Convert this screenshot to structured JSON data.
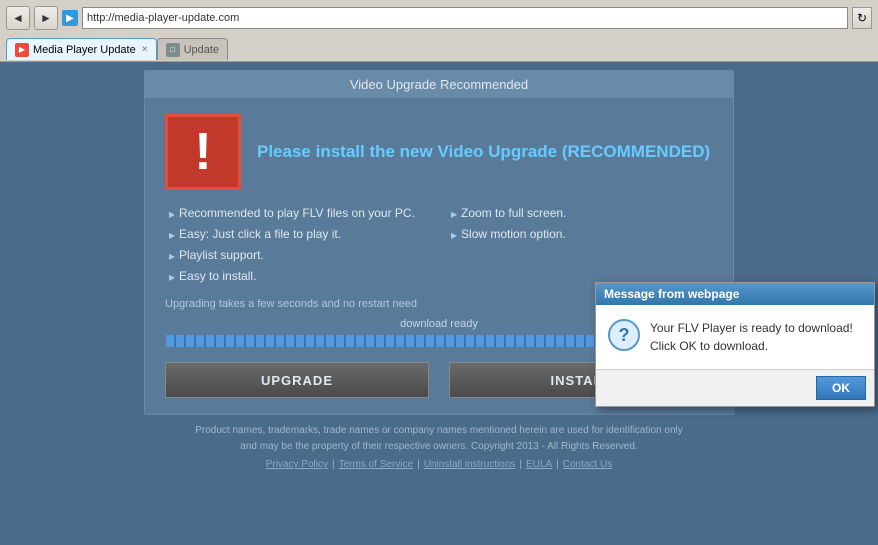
{
  "browser": {
    "back_label": "◄",
    "forward_label": "►",
    "address_value": "http://media-player-update.com",
    "refresh_label": "↻",
    "tab1": {
      "label": "Media Player Update",
      "favicon_label": "▶",
      "close_label": "×"
    },
    "tab2": {
      "label": "Update",
      "favicon_label": "□",
      "close_label": ""
    }
  },
  "card": {
    "title": "Video Upgrade Recommended",
    "headline": "Please install the new Video Upgrade",
    "headline_rec": "(RECOMMENDED)",
    "features": [
      "Recommended to play FLV files on your PC.",
      "Zoom to full screen.",
      "Easy: Just click a file to play it.",
      "Slow motion option.",
      "Playlist support.",
      "",
      "Easy to install.",
      ""
    ],
    "upgrading_text": "Upgrading takes a few seconds and no restart need",
    "progress_label": "download ready",
    "upgrade_btn": "UPGRADE",
    "install_btn": "INSTALL"
  },
  "popup": {
    "title": "Message from webpage",
    "message": "Your FLV Player is ready to download!\nClick OK to download.",
    "ok_label": "OK",
    "icon_label": "?"
  },
  "footer": {
    "disclaimer": "Product names, trademarks, trade names or company names mentioned herein are used for identification only\nand may be the property of their respective owners. Copyright 2013 - All Rights Reserved.",
    "links": [
      "Privacy Policy",
      "Terms of Service",
      "Uninstall instructions",
      "EULA",
      "Contact Us"
    ]
  }
}
